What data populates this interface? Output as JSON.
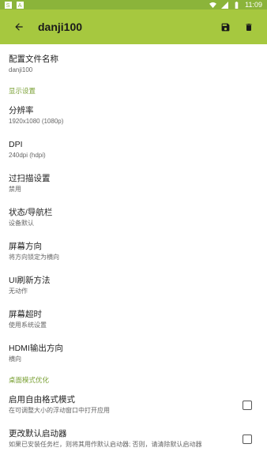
{
  "status": {
    "time": "11:09",
    "left_icons": [
      "s-icon",
      "a-icon"
    ]
  },
  "appbar": {
    "title": "danji100",
    "save_icon": "save-icon",
    "delete_icon": "delete-icon",
    "back_icon": "arrow-back-icon"
  },
  "config": {
    "title": "配置文件名称",
    "value": "danji100"
  },
  "display_section": {
    "label": "显示设置"
  },
  "items": [
    {
      "title": "分辨率",
      "subtitle": "1920x1080 (1080p)"
    },
    {
      "title": "DPI",
      "subtitle": "240dpi (hdpi)"
    },
    {
      "title": "过扫描设置",
      "subtitle": "禁用"
    },
    {
      "title": "状态/导航栏",
      "subtitle": "设备默认"
    },
    {
      "title": "屏幕方向",
      "subtitle": "将方向锁定为横向"
    },
    {
      "title": "UI刷新方法",
      "subtitle": "无动作"
    },
    {
      "title": "屏幕超时",
      "subtitle": "使用系统设置"
    },
    {
      "title": "HDMI输出方向",
      "subtitle": "横向"
    }
  ],
  "desktop_section": {
    "label": "桌面模式优化"
  },
  "checks": [
    {
      "title": "启用自由格式模式",
      "subtitle": "在可调整大小的浮动窗口中打开应用",
      "checked": false
    },
    {
      "title": "更改默认启动器",
      "subtitle": "如果已安装任务栏，则将其用作默认启动器; 否则，请清除默认启动器",
      "checked": false
    }
  ]
}
